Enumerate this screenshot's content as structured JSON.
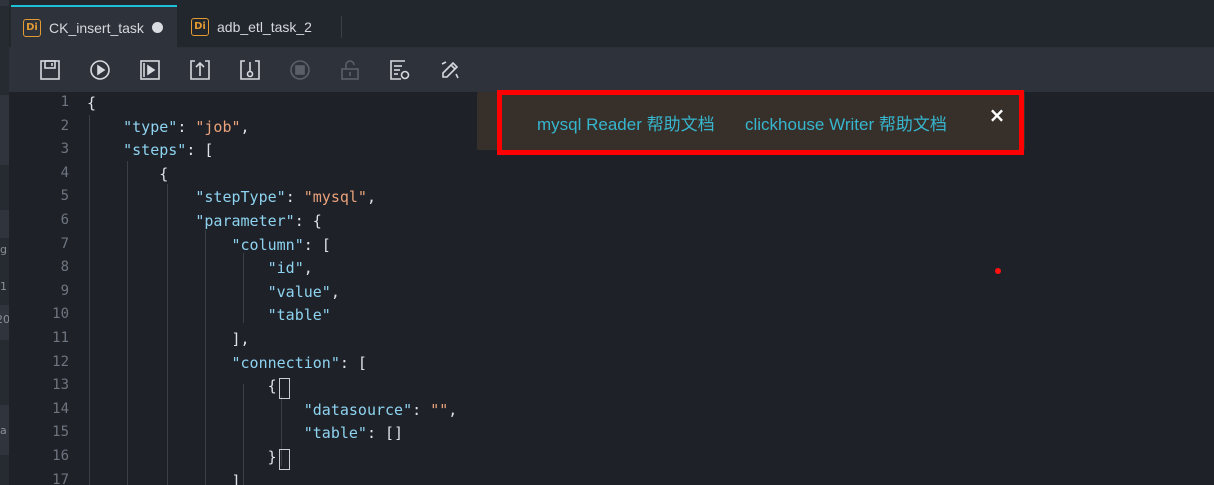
{
  "left_strip": {
    "fragments": [
      "g",
      "1",
      "20",
      "a"
    ]
  },
  "tabs": [
    {
      "badge": "Di",
      "label": "CK_insert_task",
      "active": true,
      "modified": true
    },
    {
      "badge": "Di",
      "label": "adb_etl_task_2",
      "active": false,
      "modified": false
    }
  ],
  "toolbar": {
    "tools": [
      "save-icon",
      "run-icon",
      "run-parameters-icon",
      "publish-icon",
      "deploy-icon",
      "stop-icon",
      "lock-icon",
      "format-icon",
      "edit-icon"
    ]
  },
  "help": {
    "links": [
      "mysql Reader 帮助文档",
      "clickhouse Writer 帮助文档"
    ],
    "close_label": "×"
  },
  "editor": {
    "line_numbers": [
      "1",
      "2",
      "3",
      "4",
      "5",
      "6",
      "7",
      "8",
      "9",
      "10",
      "11",
      "12",
      "13",
      "14",
      "15",
      "16",
      "17"
    ],
    "lines": [
      [
        [
          "p",
          "{"
        ]
      ],
      [
        [
          "p",
          "    "
        ],
        [
          "k",
          "\"type\""
        ],
        [
          "p",
          ": "
        ],
        [
          "s",
          "\"job\""
        ],
        [
          "p",
          ","
        ]
      ],
      [
        [
          "p",
          "    "
        ],
        [
          "k",
          "\"steps\""
        ],
        [
          "p",
          ": ["
        ]
      ],
      [
        [
          "p",
          "        {"
        ]
      ],
      [
        [
          "p",
          "            "
        ],
        [
          "k",
          "\"stepType\""
        ],
        [
          "p",
          ": "
        ],
        [
          "s",
          "\"mysql\""
        ],
        [
          "p",
          ","
        ]
      ],
      [
        [
          "p",
          "            "
        ],
        [
          "k",
          "\"parameter\""
        ],
        [
          "p",
          ": {"
        ]
      ],
      [
        [
          "p",
          "                "
        ],
        [
          "k",
          "\"column\""
        ],
        [
          "p",
          ": ["
        ]
      ],
      [
        [
          "p",
          "                    "
        ],
        [
          "k",
          "\"id\""
        ],
        [
          "p",
          ","
        ]
      ],
      [
        [
          "p",
          "                    "
        ],
        [
          "k",
          "\"value\""
        ],
        [
          "p",
          ","
        ]
      ],
      [
        [
          "p",
          "                    "
        ],
        [
          "k",
          "\"table\""
        ]
      ],
      [
        [
          "p",
          "                ],"
        ]
      ],
      [
        [
          "p",
          "                "
        ],
        [
          "k",
          "\"connection\""
        ],
        [
          "p",
          ": ["
        ]
      ],
      [
        [
          "p",
          "                    {"
        ]
      ],
      [
        [
          "p",
          "                        "
        ],
        [
          "k",
          "\"datasource\""
        ],
        [
          "p",
          ": "
        ],
        [
          "s",
          "\"\""
        ],
        [
          "p",
          ","
        ]
      ],
      [
        [
          "p",
          "                        "
        ],
        [
          "k",
          "\"table\""
        ],
        [
          "p",
          ": []"
        ]
      ],
      [
        [
          "p",
          "                    }"
        ]
      ],
      [
        [
          "p",
          "                ]"
        ]
      ]
    ]
  },
  "colors": {
    "accent": "#1ec0d8",
    "badge": "#e39a32",
    "link": "#36b6cf",
    "key": "#8ed3ef",
    "string": "#e9a27a",
    "highlight": "#ff0000"
  }
}
